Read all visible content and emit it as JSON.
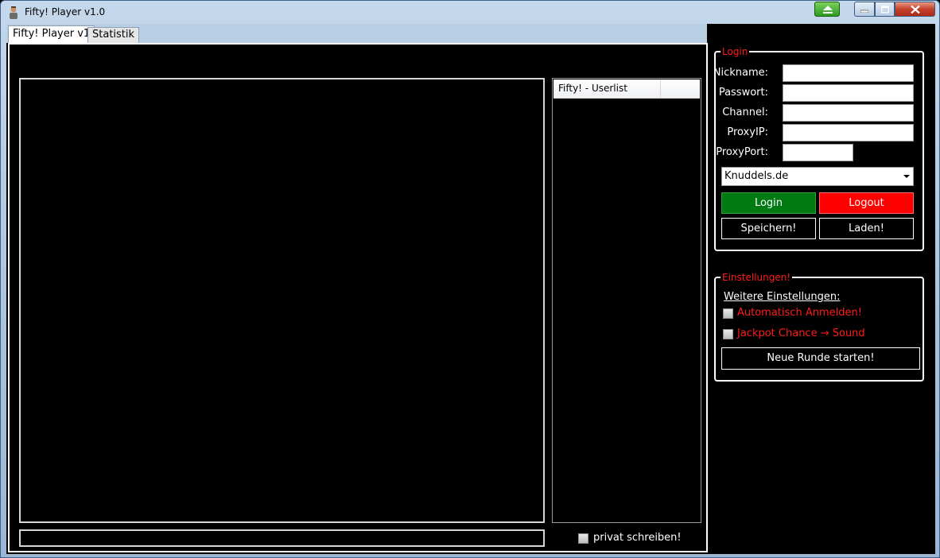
{
  "window": {
    "title": "Fifty! Player v1.0"
  },
  "tabs": [
    {
      "label": "Fifty! Player v1"
    },
    {
      "label": "Statistik"
    }
  ],
  "chat": {
    "message_value": ""
  },
  "userlist": {
    "header": "Fifty! - Userlist"
  },
  "private": {
    "label": "privat schreiben!"
  },
  "login": {
    "legend": "Login",
    "fields": {
      "nickname_label": "Nickname:",
      "password_label": "Passwort:",
      "channel_label": "Channel:",
      "proxyip_label": "ProxyIP:",
      "proxyport_label": "ProxyPort:"
    },
    "server_selected": "Knuddels.de",
    "login_label": "Login",
    "logout_label": "Logout",
    "save_label": "Speichern!",
    "load_label": "Laden!"
  },
  "settings": {
    "legend": "Einstellungen!",
    "heading": "Weitere Einstellungen:",
    "auto_login_label": "Automatisch Anmelden!",
    "jackpot_label": "Jackpot Chance → Sound",
    "new_round_label": "Neue Runde starten!"
  },
  "colors": {
    "accent_red": "#ff1a1a",
    "login_green": "#007a12",
    "logout_red": "#ff0000"
  }
}
